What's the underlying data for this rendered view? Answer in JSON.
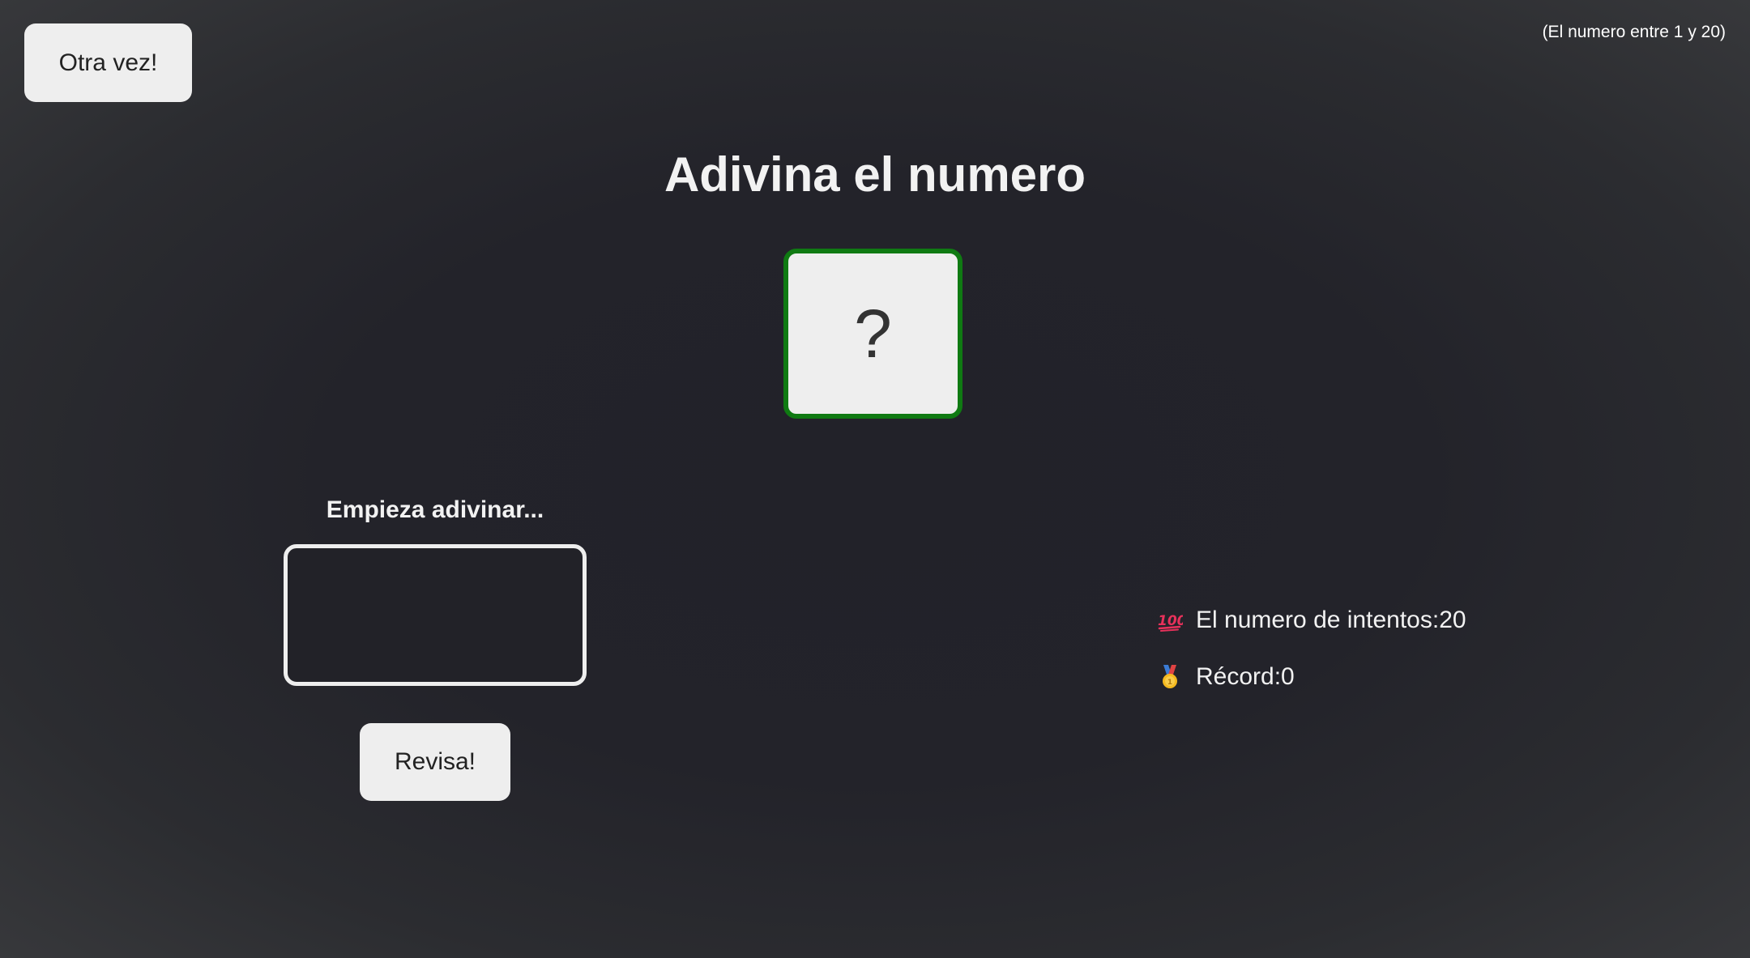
{
  "header": {
    "again_label": "Otra vez!",
    "range_hint": "(El numero entre 1 y 20)"
  },
  "title": "Adivina el numero",
  "secret": {
    "display": "?",
    "border_color": "#0f7a12"
  },
  "game": {
    "message": "Empieza adivinar...",
    "guess_value": "",
    "check_label": "Revisa!"
  },
  "stats": {
    "attempts_icon": "hundred-points-icon",
    "attempts_label": "El numero de intentos: ",
    "attempts_value": "20",
    "record_icon": "medal-icon",
    "record_label": "Récord: ",
    "record_value": "0"
  }
}
